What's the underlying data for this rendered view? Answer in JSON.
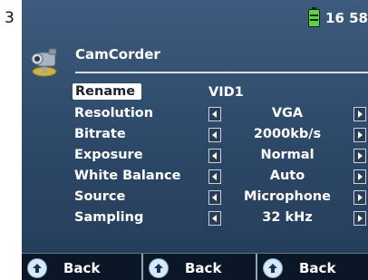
{
  "page_number": "3",
  "status": {
    "time": "16 58"
  },
  "app": {
    "title": "CamCorder"
  },
  "settings": [
    {
      "label": "Rename",
      "value": "VID1",
      "selected": true,
      "has_arrows": false
    },
    {
      "label": "Resolution",
      "value": "VGA",
      "selected": false,
      "has_arrows": true
    },
    {
      "label": "Bitrate",
      "value": "2000kb/s",
      "selected": false,
      "has_arrows": true
    },
    {
      "label": "Exposure",
      "value": "Normal",
      "selected": false,
      "has_arrows": true
    },
    {
      "label": "White Balance",
      "value": "Auto",
      "selected": false,
      "has_arrows": true
    },
    {
      "label": "Source",
      "value": "Microphone",
      "selected": false,
      "has_arrows": true
    },
    {
      "label": "Sampling",
      "value": "32 kHz",
      "selected": false,
      "has_arrows": true
    }
  ],
  "bottom_buttons": [
    {
      "label": "Back"
    },
    {
      "label": "Back"
    },
    {
      "label": "Back"
    }
  ],
  "colors": {
    "screen_bg": "#2c4766",
    "bottom_bar_bg": "#0b1727",
    "battery": "#5ed14a"
  }
}
